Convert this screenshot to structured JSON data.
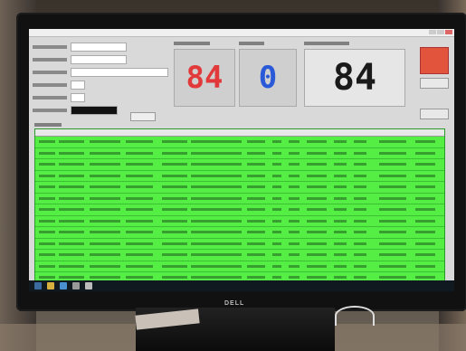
{
  "display": {
    "first_counter": {
      "value": "84",
      "color": "#e23a3a"
    },
    "second_counter": {
      "value": "0",
      "color": "#2b5ad9"
    },
    "main_counter": {
      "value": "84",
      "color": "#1a1a1a"
    }
  },
  "monitor": {
    "brand": "DELL"
  },
  "grid": {
    "row_color": "#55ee44"
  }
}
